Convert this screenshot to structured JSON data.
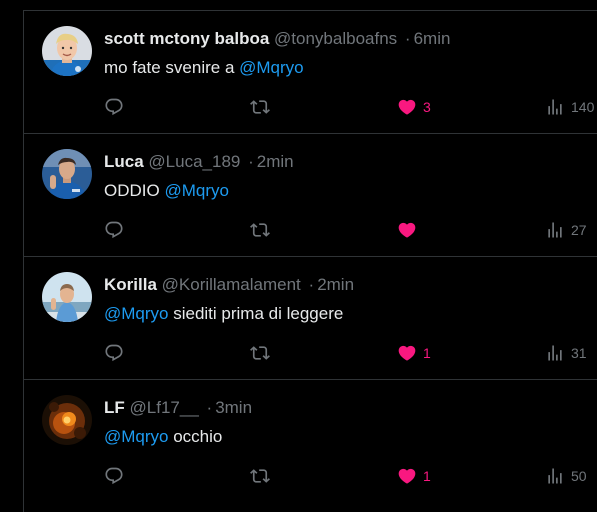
{
  "colors": {
    "background": "#000000",
    "text": "#e7e9ea",
    "muted": "#71767b",
    "mention": "#1d9bf0",
    "like": "#f91880",
    "divider": "#2f3336"
  },
  "tweets": [
    {
      "name": "scott mctony balboa",
      "handle": "@tonybalboafns",
      "separator": "·",
      "time": "6min",
      "text_before": "mo fate svenire a ",
      "mention": "@Mqryo",
      "text_after": "",
      "likes": "3",
      "views": "140",
      "avatar_icon": "avatar-blond-man-blue-jersey"
    },
    {
      "name": "Luca",
      "handle": "@Luca_189",
      "separator": "·",
      "time": "2min",
      "text_before": "ODDIO ",
      "mention": "@Mqryo",
      "text_after": "",
      "likes": "",
      "views": "27",
      "avatar_icon": "avatar-player-blue-jersey"
    },
    {
      "name": "Korilla",
      "handle": "@Korillamalament",
      "separator": "·",
      "time": "2min",
      "text_before": "",
      "mention": "@Mqryo",
      "text_after": " siediti prima di leggere",
      "likes": "1",
      "views": "31",
      "avatar_icon": "avatar-person-sky"
    },
    {
      "name": "LF",
      "handle": "@Lf17__",
      "separator": "·",
      "time": "3min",
      "text_before": "",
      "mention": "@Mqryo",
      "text_after": " occhio",
      "likes": "1",
      "views": "50",
      "avatar_icon": "avatar-dark-fire"
    }
  ],
  "action_icons": {
    "reply": "reply-icon",
    "retweet": "retweet-icon",
    "like": "heart-icon",
    "views": "views-icon"
  }
}
